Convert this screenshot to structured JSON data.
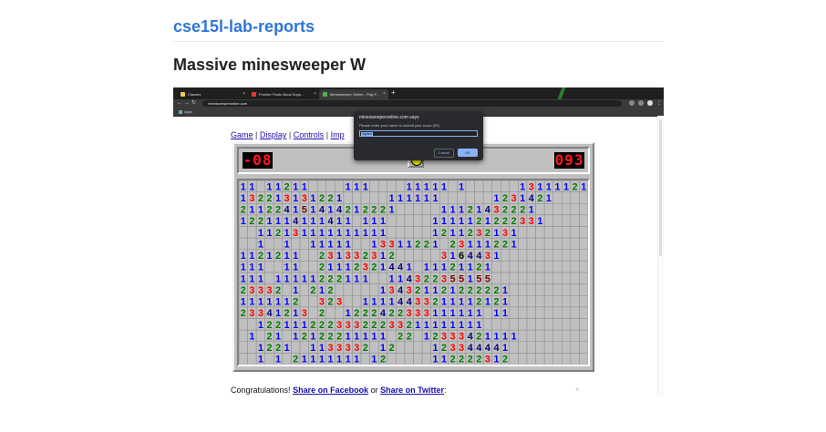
{
  "site": {
    "title": "cse15l-lab-reports"
  },
  "post": {
    "title": "Massive minesweeper W"
  },
  "browser": {
    "tabs": [
      {
        "label": "Classes",
        "active": false,
        "icon": "yellow-square-icon",
        "color": "#f2c94c"
      },
      {
        "label": "Frontier Panto Book Supp...",
        "active": false,
        "icon": "red-square-icon",
        "color": "#e53935"
      },
      {
        "label": "Minesweeper Online - Play F...",
        "active": true,
        "icon": "mine-icon",
        "color": "#4caf50"
      }
    ],
    "new_tab": "+",
    "url": "minesweeperonline.com",
    "bookmarks": {
      "apps": "Apps"
    }
  },
  "game": {
    "links": [
      "Game",
      "Display",
      "Controls",
      "Imp"
    ],
    "mine_counter": "-08",
    "timer": "093",
    "face": "smiley-icon"
  },
  "dialog": {
    "title": "minesweeperonline.com says",
    "message": "Please enter your name to submit your score (93)",
    "input_value": "rajabn",
    "cancel": "Cancel",
    "ok": "OK"
  },
  "footer": {
    "prefix": "Congratulations!",
    "share_facebook": "Share on Facebook",
    "middle": "or",
    "share_twitter": "Share on Twitter",
    "suffix": ":",
    "close": "×"
  },
  "colors": {
    "link": "#2f75d6",
    "n1": "#0000ff",
    "n2": "#007b00",
    "n3": "#ff0000",
    "n4": "#00007b",
    "n5": "#7b0000",
    "cell": "#c0c0c0"
  },
  "board_rows": [
    "11.11211....111....11111.1......13111121",
    "132213131221.....111111......1231421...",
    "211224151414212221.....11121432221.....",
    "1221114111411.111.....1111121222331.....",
    "..112131111111111.....1211232131.......",
    "..1..1..11111..13311221.23111221.......",
    "1121211..231332312.....3164431.........",
    "111..11..21112321441.11121121..........",
    "111.11111222111..114322355155..........",
    "23332.1.212.....134321121222221........",
    "1111112..323..11114433211112121........",
    "23341213.2..1222422333111111.11........",
    "..12211122233322233211111111...........",
    ".1.21.12122211111.22.12333421111.......",
    "..1221..1133332.12....123344441........",
    "..1.1.21111111.12.....112222312........"
  ]
}
